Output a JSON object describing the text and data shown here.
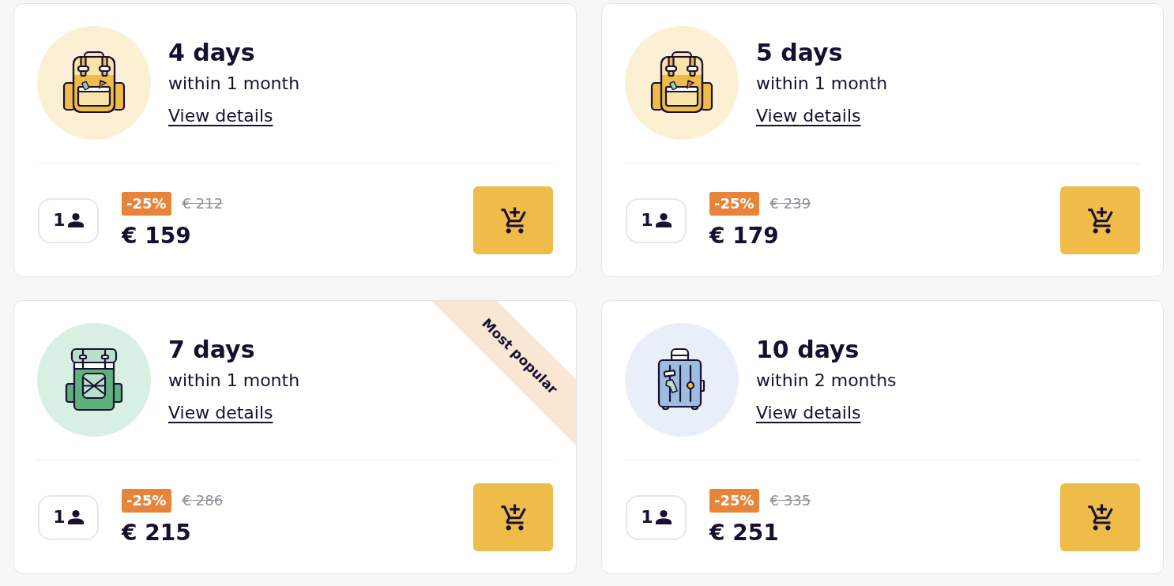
{
  "plans": [
    {
      "kind": "backpack",
      "title": "4 days",
      "validity": "within 1 month",
      "link": "View details",
      "travelers": "1",
      "discount": "-25%",
      "old_price": "€ 212",
      "price": "€ 159"
    },
    {
      "kind": "backpack",
      "title": "5 days",
      "validity": "within 1 month",
      "link": "View details",
      "travelers": "1",
      "discount": "-25%",
      "old_price": "€ 239",
      "price": "€ 179"
    },
    {
      "kind": "hiking-backpack",
      "title": "7 days",
      "validity": "within 1 month",
      "link": "View details",
      "travelers": "1",
      "discount": "-25%",
      "old_price": "€ 286",
      "price": "€ 215",
      "ribbon": "Most popular"
    },
    {
      "kind": "suitcase",
      "title": "10 days",
      "validity": "within 2 months",
      "link": "View details",
      "travelers": "1",
      "discount": "-25%",
      "old_price": "€ 335",
      "price": "€ 251"
    }
  ]
}
